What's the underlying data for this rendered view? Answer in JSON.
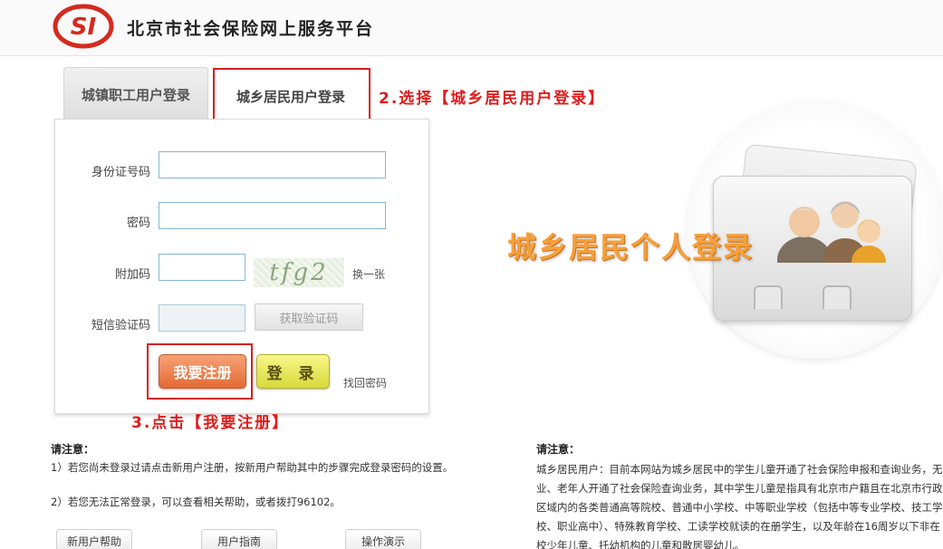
{
  "header": {
    "logo_text": "SI",
    "title": "北京市社会保险网上服务平台"
  },
  "tabs": {
    "worker": "城镇职工用户登录",
    "resident": "城乡居民用户登录"
  },
  "annotations": {
    "step2": "2.选择【城乡居民用户登录】",
    "step3": "3.点击【我要注册】"
  },
  "form": {
    "id_label": "身份证号码",
    "id_value": "",
    "password_label": "密码",
    "password_value": "",
    "captcha_label": "附加码",
    "captcha_value": "",
    "captcha_image_text": "tfg2",
    "captcha_refresh": "换一张",
    "sms_label": "短信验证码",
    "sms_value": "",
    "sms_button": "获取验证码",
    "register_button": "我要注册",
    "login_button": "登 录",
    "forgot_password": "找回密码"
  },
  "illustration": {
    "title": "城乡居民个人登录"
  },
  "notice_left": {
    "title": "请注意：",
    "lines": [
      "1）若您尚未登录过请点击新用户注册，按新用户帮助其中的步骤完成登录密码的设置。",
      "2）若您无法正常登录，可以查看相关帮助，或者拨打96102。"
    ]
  },
  "notice_right": {
    "title": "请注意：",
    "text": "城乡居民用户：目前本网站为城乡居民中的学生儿童开通了社会保险申报和查询业务，无业、老年人开通了社会保险查询业务，其中学生儿童是指具有北京市户籍且在北京市行政区域内的各类普通高等院校、普通中小学校、中等职业学校（包括中等专业学校、技工学校、职业高中）、特殊教育学校、工读学校就读的在册学生，以及年龄在16周岁以下非在校少年儿童、托幼机构的儿童和散居婴幼儿。"
  },
  "bottom_buttons": {
    "help": "新用户帮助",
    "guide": "用户指南",
    "demo": "操作演示"
  },
  "colors": {
    "annotation_red": "#d91e1e",
    "register_orange": "#e36a35",
    "login_yellow": "#d8d93a",
    "illustration_orange": "#f6a03b"
  }
}
